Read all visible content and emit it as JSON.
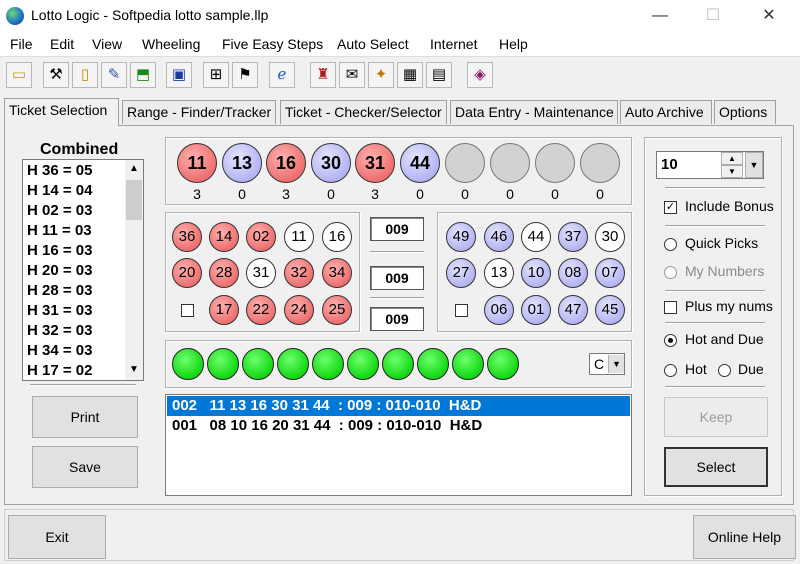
{
  "window": {
    "title": "Lotto Logic - Softpedia lotto sample.llp",
    "minimize": "—",
    "maximize": "☐",
    "close": "✕"
  },
  "menu": [
    "File",
    "Edit",
    "View",
    "Wheeling",
    "Five Easy Steps",
    "Auto Select",
    "Internet",
    "Help"
  ],
  "toolbar_icons": [
    "open-folder-icon",
    "tools-icon",
    "notebook-icon",
    "edit-ticket-icon",
    "export-icon",
    "monitor-icon",
    "wheel-icon",
    "chart-icon",
    "browser-icon",
    "lottery-machine-icon",
    "ticket-icon",
    "wizard-icon",
    "table-icon",
    "save-icon",
    "book-icon"
  ],
  "tabs": [
    "Ticket Selection",
    "Range - Finder/Tracker",
    "Ticket - Checker/Selector",
    "Data Entry - Maintenance",
    "Auto Archive",
    "Options"
  ],
  "combined": {
    "title": "Combined",
    "items": [
      "H 36 = 05",
      "H 14 = 04",
      "H 02 = 03",
      "H 11 = 03",
      "H 16 = 03",
      "H 20 = 03",
      "H 28 = 03",
      "H 31 = 03",
      "H 32 = 03",
      "H 34 = 03",
      "H 17 = 02"
    ]
  },
  "buttons": {
    "print": "Print",
    "save": "Save",
    "keep": "Keep",
    "select": "Select",
    "exit": "Exit",
    "online_help": "Online Help"
  },
  "top_balls": [
    {
      "num": "11",
      "color": "red",
      "count": "3"
    },
    {
      "num": "13",
      "color": "blue",
      "count": "0"
    },
    {
      "num": "16",
      "color": "red",
      "count": "3"
    },
    {
      "num": "30",
      "color": "blue",
      "count": "0"
    },
    {
      "num": "31",
      "color": "red",
      "count": "3"
    },
    {
      "num": "44",
      "color": "blue",
      "count": "0"
    },
    {
      "num": "",
      "color": "gray",
      "count": "0"
    },
    {
      "num": "",
      "color": "gray",
      "count": "0"
    },
    {
      "num": "",
      "color": "gray",
      "count": "0"
    },
    {
      "num": "",
      "color": "gray",
      "count": "0"
    }
  ],
  "hot_balls": [
    [
      {
        "num": "36",
        "color": "red"
      },
      {
        "num": "14",
        "color": "red"
      },
      {
        "num": "02",
        "color": "red"
      },
      {
        "num": "11",
        "color": "white"
      },
      {
        "num": "16",
        "color": "white"
      }
    ],
    [
      {
        "num": "20",
        "color": "red"
      },
      {
        "num": "28",
        "color": "red"
      },
      {
        "num": "31",
        "color": "white"
      },
      {
        "num": "32",
        "color": "red"
      },
      {
        "num": "34",
        "color": "red"
      }
    ],
    [
      {
        "num": "17",
        "color": "red"
      },
      {
        "num": "22",
        "color": "red"
      },
      {
        "num": "24",
        "color": "red"
      },
      {
        "num": "25",
        "color": "red"
      }
    ]
  ],
  "due_balls": [
    [
      {
        "num": "49",
        "color": "blue"
      },
      {
        "num": "46",
        "color": "blue"
      },
      {
        "num": "44",
        "color": "white"
      },
      {
        "num": "37",
        "color": "blue"
      },
      {
        "num": "30",
        "color": "white"
      }
    ],
    [
      {
        "num": "27",
        "color": "blue"
      },
      {
        "num": "13",
        "color": "white"
      },
      {
        "num": "10",
        "color": "blue"
      },
      {
        "num": "08",
        "color": "blue"
      },
      {
        "num": "07",
        "color": "blue"
      }
    ],
    [
      {
        "num": "06",
        "color": "blue"
      },
      {
        "num": "01",
        "color": "blue"
      },
      {
        "num": "47",
        "color": "blue"
      },
      {
        "num": "45",
        "color": "blue"
      }
    ]
  ],
  "center_boxes": [
    "009",
    "009",
    "009"
  ],
  "green_ball_count": 10,
  "c_dropdown": "C",
  "tickets": [
    "002   11 13 16 30 31 44  : 009 : 010-010  H&D",
    "001   08 10 16 20 31 44  : 009 : 010-010  H&D"
  ],
  "options": {
    "spin_value": "10",
    "include_bonus": "Include Bonus",
    "quick_picks": "Quick Picks",
    "my_numbers": "My Numbers",
    "plus_my_nums": "Plus my nums",
    "hot_and_due": "Hot and Due",
    "hot": "Hot",
    "due": "Due"
  },
  "colors": {
    "red": "#ef6f6f",
    "blue": "#b4b4f4",
    "green": "#12d812",
    "selection": "#0078d7"
  }
}
